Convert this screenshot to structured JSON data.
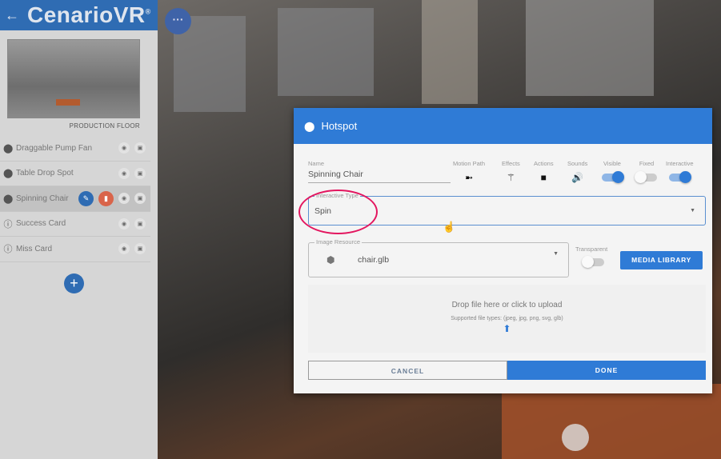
{
  "brand": {
    "name": "CenarioVR",
    "mark": "®"
  },
  "sidebar": {
    "scene_label": "PRODUCTION FLOOR",
    "items": [
      {
        "label": "Draggable Pump Fan",
        "icon": "map-pin-icon"
      },
      {
        "label": "Table Drop Spot",
        "icon": "map-pin-icon"
      },
      {
        "label": "Spinning Chair",
        "icon": "map-pin-icon",
        "selected": true
      },
      {
        "label": "Success Card",
        "icon": "info-icon"
      },
      {
        "label": "Miss Card",
        "icon": "info-icon"
      }
    ],
    "add_label": "+"
  },
  "menu_label": "···",
  "dialog": {
    "title": "Hotspot",
    "name_label": "Name",
    "name_value": "Spinning Chair",
    "tools": [
      "Motion Path",
      "Effects",
      "Actions",
      "Sounds"
    ],
    "toggles": [
      {
        "label": "Visible",
        "on": true
      },
      {
        "label": "Fixed",
        "on": false
      },
      {
        "label": "Interactive",
        "on": true
      }
    ],
    "interactive_type_label": "Interactive Type",
    "interactive_type_value": "Spin",
    "image_resource_label": "Image Resource",
    "image_resource_value": "chair.glb",
    "transparent_label": "Transparent",
    "transparent_on": false,
    "media_library": "MEDIA LIBRARY",
    "drop_text": "Drop file here or click to upload",
    "supported": "Supported file types: (jpeg, jpg, png, svg, glb)",
    "cancel": "CANCEL",
    "done": "DONE"
  },
  "colors": {
    "accent": "#2f7bd6",
    "highlight": "#e3165f",
    "delete": "#d9644a"
  }
}
